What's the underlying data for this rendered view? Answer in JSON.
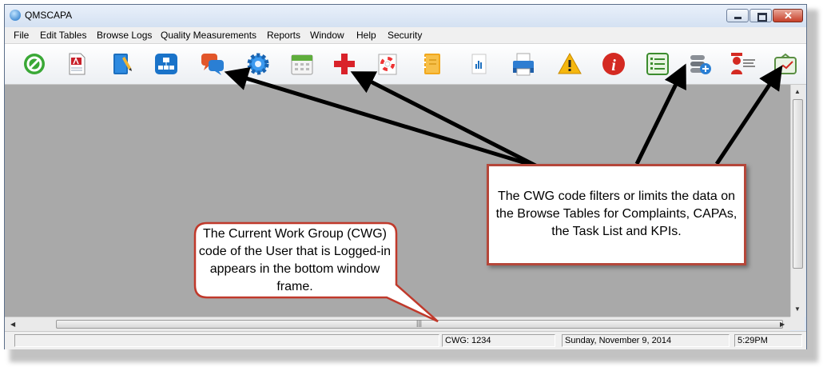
{
  "window": {
    "title": "QMSCAPA"
  },
  "menu": [
    "File",
    "Edit Tables",
    "Browse Logs",
    "Quality Measurements",
    "Reports",
    "Window",
    "Help",
    "Security"
  ],
  "toolbar": {
    "icons": [
      "exit-icon",
      "adobe-pdf-icon",
      "notebook-icon",
      "org-chart-icon",
      "chat-bubbles-icon",
      "gear-icon",
      "calendar-icon",
      "red-cross-icon",
      "lifebuoy-icon",
      "address-book-icon",
      "bar-chart-doc-icon",
      "printer-icon",
      "warning-icon",
      "info-icon",
      "task-list-icon",
      "settings-add-icon",
      "user-profile-icon",
      "kpi-chart-icon"
    ]
  },
  "status": {
    "cwg": "CWG: 1234",
    "date": "Sunday, November 9, 2014",
    "time": "5:29PM"
  },
  "annotations": {
    "cwg_filter": "The CWG code filters or limits the data on the Browse Tables for Complaints, CAPAs, the Task List and KPIs.",
    "cwg_location": "The Current Work Group (CWG) code of the User that is Logged-in appears in the bottom window frame."
  },
  "colors": {
    "callout_border": "#b5473a",
    "client_bg": "#a9a9a9",
    "arrow": "#000000"
  }
}
